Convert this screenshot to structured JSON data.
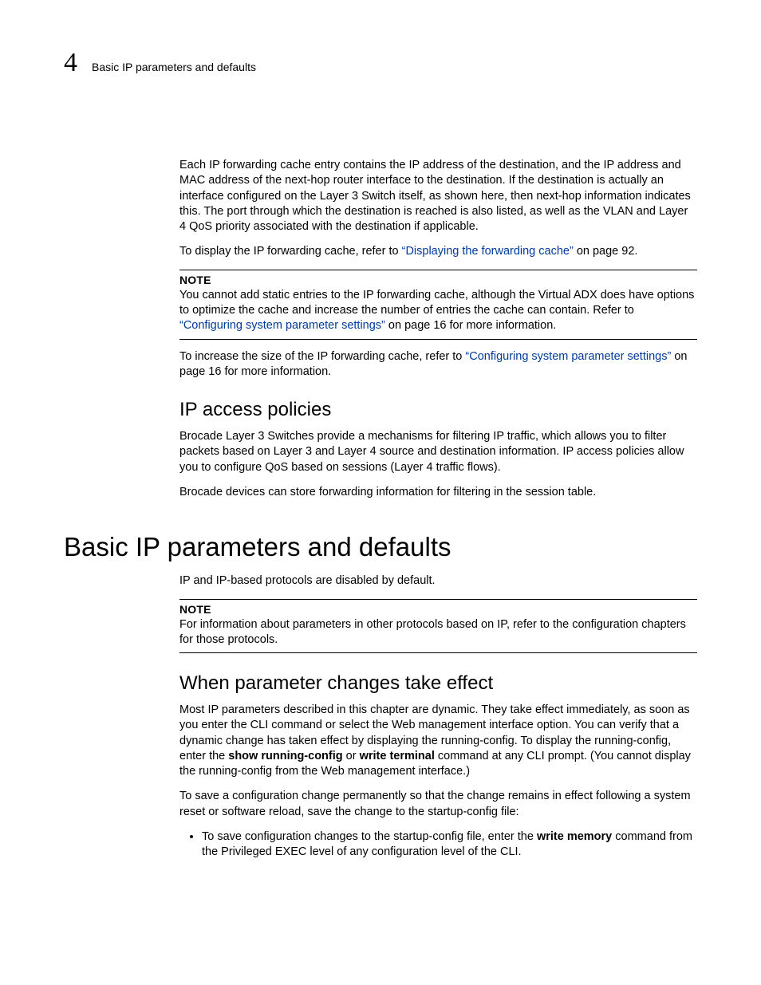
{
  "header": {
    "chapter_number": "4",
    "running_title": "Basic IP parameters and defaults"
  },
  "para1": "Each IP forwarding cache entry contains the IP address of the destination, and the IP address and MAC address of the next-hop router interface to the destination. If the destination is actually an interface configured on the Layer 3 Switch itself, as shown here, then next-hop information indicates this. The port through which the destination is reached is also listed, as well as the VLAN and Layer 4 QoS priority associated with the destination if applicable.",
  "para2_pre": "To display the IP forwarding cache, refer to ",
  "para2_link": "“Displaying the forwarding cache”",
  "para2_post": " on page 92.",
  "note1": {
    "label": "NOTE",
    "text_pre": "You cannot add static entries to the IP forwarding cache, although the Virtual ADX does have options to optimize the cache and increase the number of entries the cache can contain. Refer to ",
    "link": "“Configuring system parameter settings”",
    "text_post": " on page 16 for more information."
  },
  "para3_pre": "To increase the size of the IP forwarding cache, refer to ",
  "para3_link": "“Configuring system parameter settings”",
  "para3_post": " on page 16 for more information.",
  "section_ip_access": {
    "title": "IP access policies",
    "p1": " Brocade Layer 3 Switches provide a mechanisms for filtering IP traffic, which allows you to filter packets based on Layer 3 and Layer 4 source and destination information. IP access policies allow you to configure QoS based on sessions (Layer 4 traffic flows).",
    "p2": "Brocade devices can store forwarding information for filtering in the session table."
  },
  "chapter_title": "Basic IP parameters and defaults",
  "para4": "IP and IP-based protocols are disabled by default.",
  "note2": {
    "label": "NOTE",
    "text": "For information about parameters in other protocols based on IP, refer to the configuration chapters for those protocols."
  },
  "section_when": {
    "title": "When parameter changes take effect",
    "p1_a": "Most IP parameters described in this chapter are dynamic. They take effect immediately, as soon as you enter the CLI command or select the Web management interface option. You can verify that a dynamic change has taken effect by displaying the running-config. To display the running-config, enter the ",
    "cmd1": "show running-config",
    "p1_b": " or ",
    "cmd2": "write terminal",
    "p1_c": " command at any CLI prompt. (You cannot display the running-config from the Web management interface.)",
    "p2": "To save a configuration change permanently so that the change remains in effect following a system reset or software reload, save the change to the startup-config file:",
    "bullet_a": "To save configuration changes to the startup-config file, enter the ",
    "bullet_cmd": "write memory",
    "bullet_b": " command from the Privileged EXEC level of any configuration level of the CLI."
  }
}
